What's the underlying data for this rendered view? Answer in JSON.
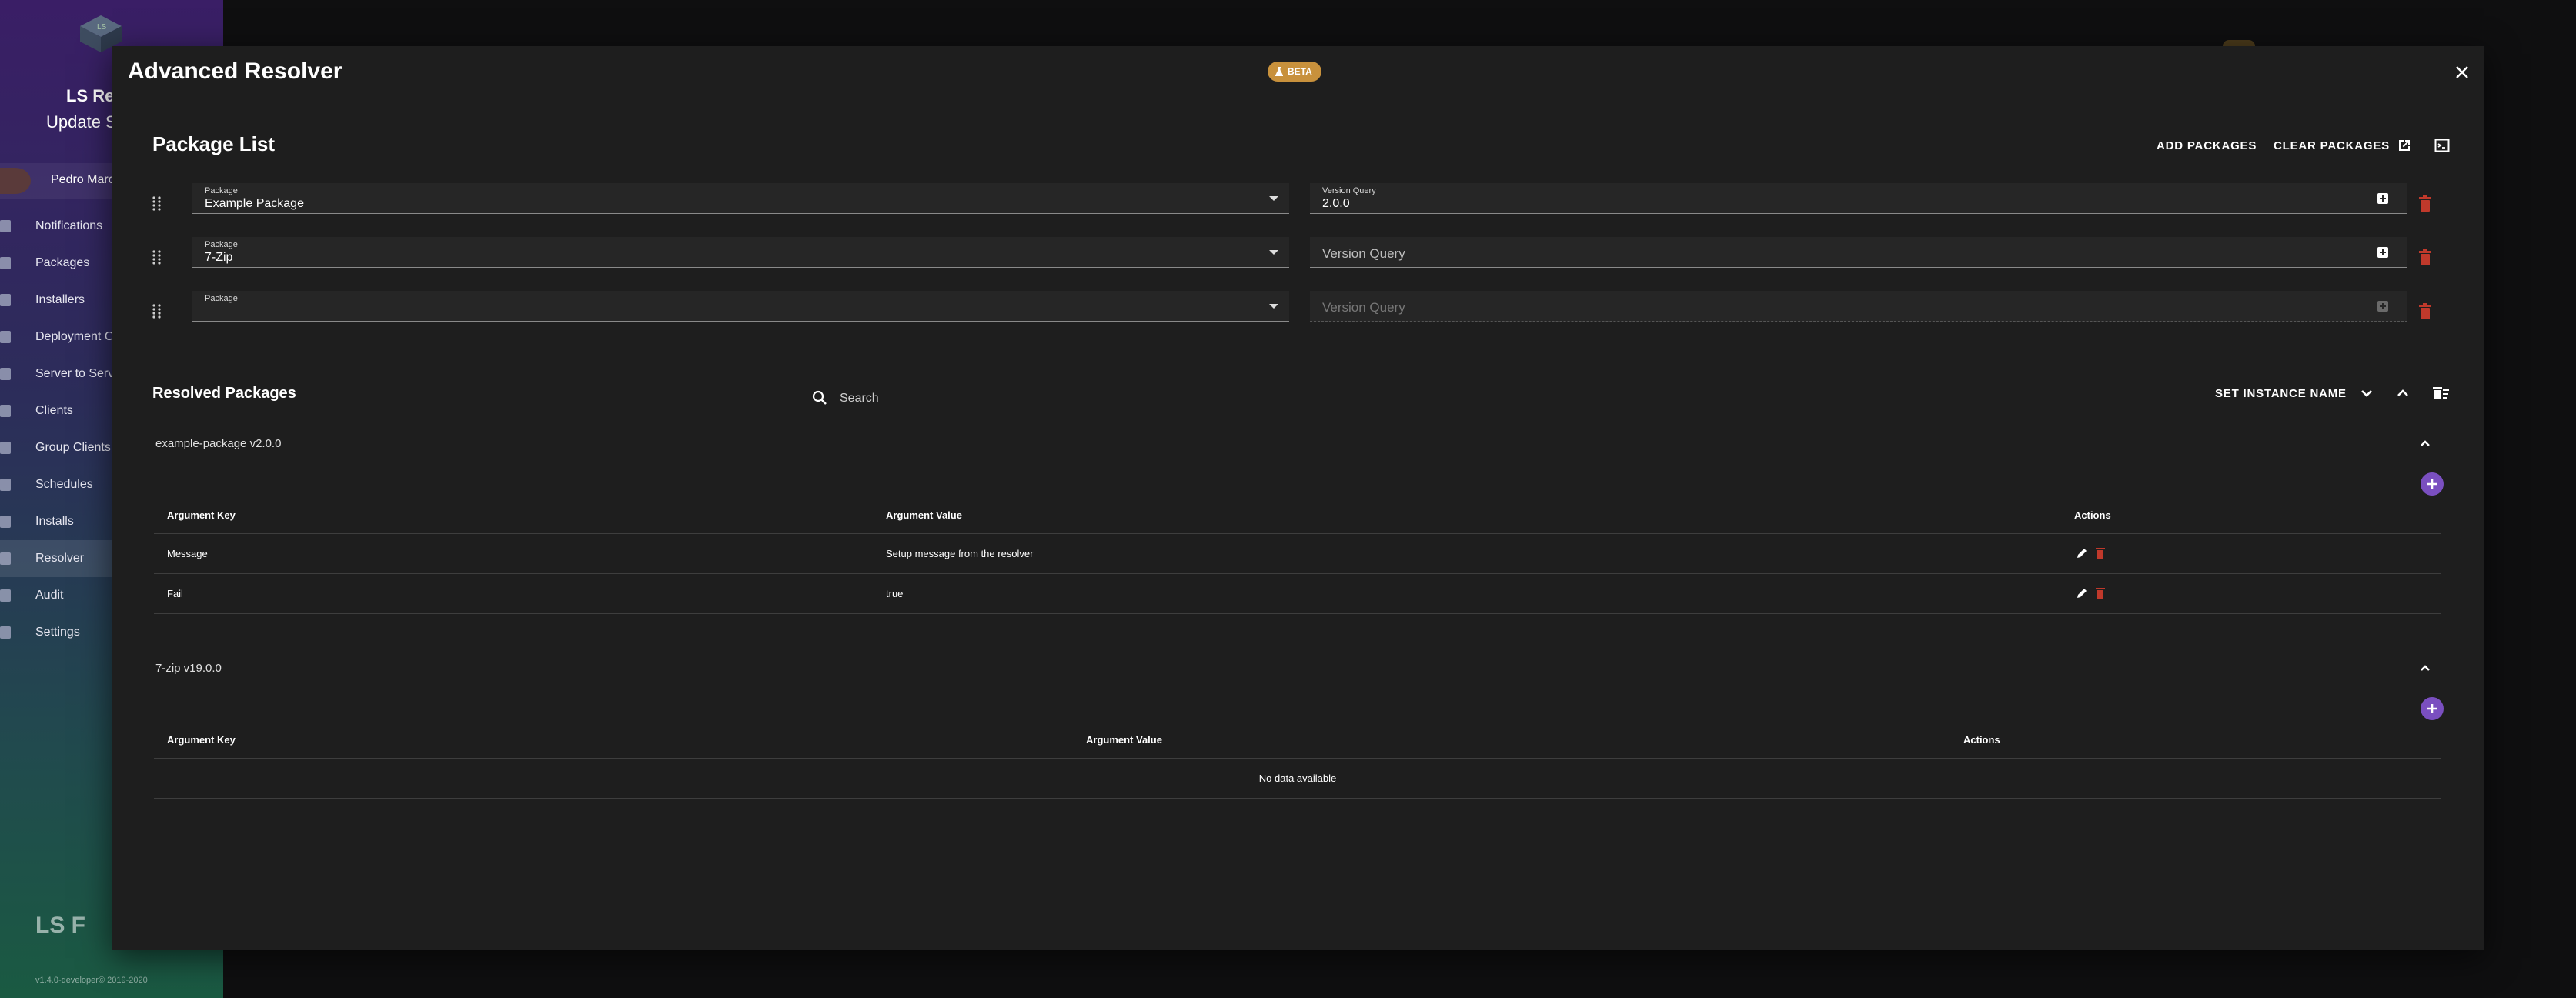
{
  "sidebar": {
    "app_name": "LS Re",
    "subtitle": "Update S",
    "user_name": "Pedro Marc",
    "items": [
      {
        "label": "Notifications",
        "icon": "bell-icon"
      },
      {
        "label": "Packages",
        "icon": "package-icon"
      },
      {
        "label": "Installers",
        "icon": "installer-icon"
      },
      {
        "label": "Deployment C",
        "icon": "deployment-icon"
      },
      {
        "label": "Server to Serv",
        "icon": "server-icon"
      },
      {
        "label": "Clients",
        "icon": "clients-icon"
      },
      {
        "label": "Group Clients",
        "icon": "group-icon"
      },
      {
        "label": "Schedules",
        "icon": "calendar-icon"
      },
      {
        "label": "Installs",
        "icon": "install-icon"
      },
      {
        "label": "Resolver",
        "icon": "resolver-icon",
        "active": true
      },
      {
        "label": "Audit",
        "icon": "audit-icon"
      },
      {
        "label": "Settings",
        "icon": "gear-icon"
      }
    ],
    "footer_logo": "LS F",
    "version": "v1.4.0-developer© 2019-2020"
  },
  "dialog": {
    "title": "Advanced Resolver",
    "beta_label": "BETA",
    "colors": {
      "accent": "#7a4fc0",
      "beta": "#c8913c",
      "danger": "#c0392b"
    }
  },
  "package_list": {
    "title": "Package List",
    "add_label": "ADD PACKAGES",
    "clear_label": "CLEAR PACKAGES",
    "rows": [
      {
        "package_label": "Package",
        "package_value": "Example Package",
        "version_label": "Version Query",
        "version_value": "2.0.0",
        "version_placeholder": ""
      },
      {
        "package_label": "Package",
        "package_value": "7-Zip",
        "version_label": "",
        "version_value": "",
        "version_placeholder": "Version Query"
      },
      {
        "package_label": "Package",
        "package_value": "",
        "version_label": "",
        "version_value": "",
        "version_placeholder": "Version Query"
      }
    ]
  },
  "resolved": {
    "title": "Resolved Packages",
    "search_placeholder": "Search",
    "set_instance_label": "SET INSTANCE NAME",
    "panels": [
      {
        "title": "example-package v2.0.0",
        "headers": {
          "key": "Argument Key",
          "value": "Argument Value",
          "actions": "Actions"
        },
        "rows": [
          {
            "key": "Message",
            "value": "Setup message from the resolver"
          },
          {
            "key": "Fail",
            "value": "true"
          }
        ]
      },
      {
        "title": "7-zip v19.0.0",
        "headers": {
          "key": "Argument Key",
          "value": "Argument Value",
          "actions": "Actions"
        },
        "empty_text": "No data available"
      }
    ]
  }
}
